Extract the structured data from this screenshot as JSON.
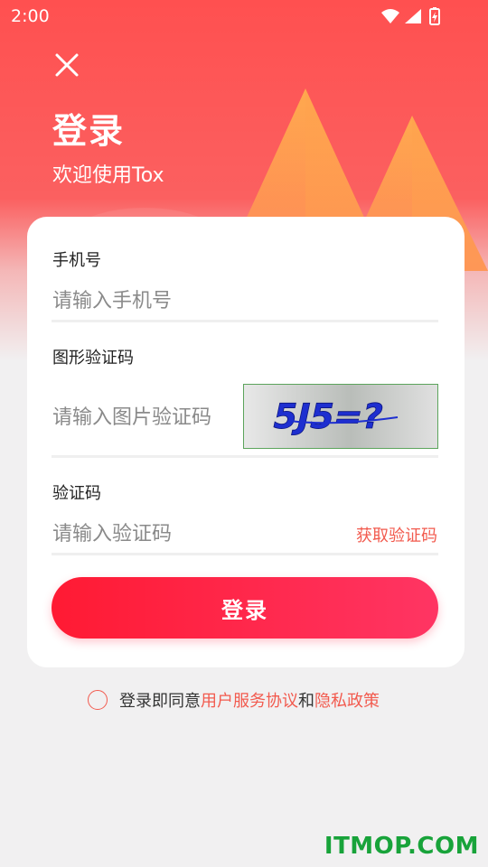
{
  "status_bar": {
    "time": "2:00"
  },
  "header": {
    "title": "登录",
    "subtitle": "欢迎使用Tox"
  },
  "form": {
    "phone": {
      "label": "手机号",
      "placeholder": "请输入手机号"
    },
    "captcha": {
      "label": "图形验证码",
      "placeholder": "请输入图片验证码",
      "image_text": "5J5=?"
    },
    "code": {
      "label": "验证码",
      "placeholder": "请输入验证码",
      "get_code": "获取验证码"
    },
    "submit": "登录"
  },
  "agreement": {
    "prefix": "登录即同意",
    "terms_link": "用户服务协议",
    "joiner": "和",
    "privacy_link": "隐私政策"
  },
  "watermark": "ITMOP.COM",
  "colors": {
    "primary_red": "#ff4f4f",
    "button_start": "#ff1a33",
    "button_end": "#ff3563",
    "link": "#f25a4e"
  }
}
